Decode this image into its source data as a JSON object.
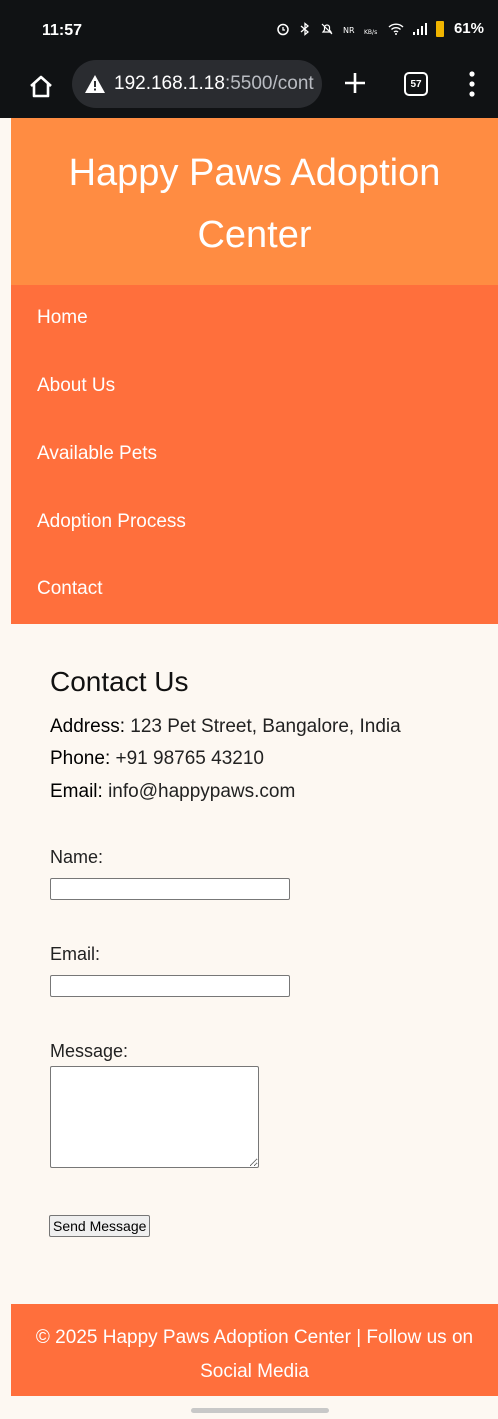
{
  "status_bar": {
    "time": "11:57",
    "battery": "61%"
  },
  "browser": {
    "url_host": "192.168.1.18",
    "url_path": ":5500/cont",
    "tab_count": "57"
  },
  "header": {
    "title": "Happy Paws Adoption Center"
  },
  "nav": {
    "items": [
      {
        "label": "Home"
      },
      {
        "label": "About Us"
      },
      {
        "label": "Available Pets"
      },
      {
        "label": "Adoption Process"
      },
      {
        "label": "Contact"
      }
    ]
  },
  "contact": {
    "title": "Contact Us",
    "address_label": "Address:",
    "address_value": "123 Pet Street, Bangalore, India",
    "phone_label": "Phone:",
    "phone_value": "+91 98765 43210",
    "email_label": "Email:",
    "email_value": "info@happypaws.com"
  },
  "form": {
    "name_label": "Name:",
    "name_value": "",
    "email_label": "Email:",
    "email_value": "",
    "message_label": "Message:",
    "message_value": "",
    "submit_label": "Send Message"
  },
  "footer": {
    "text": "© 2025 Happy Paws Adoption Center | Follow us on Social Media"
  },
  "colors": {
    "header_bg": "#ff8c42",
    "nav_bg": "#ff6f3c",
    "page_bg": "#fdf8f2",
    "browser_bg": "#101214"
  }
}
